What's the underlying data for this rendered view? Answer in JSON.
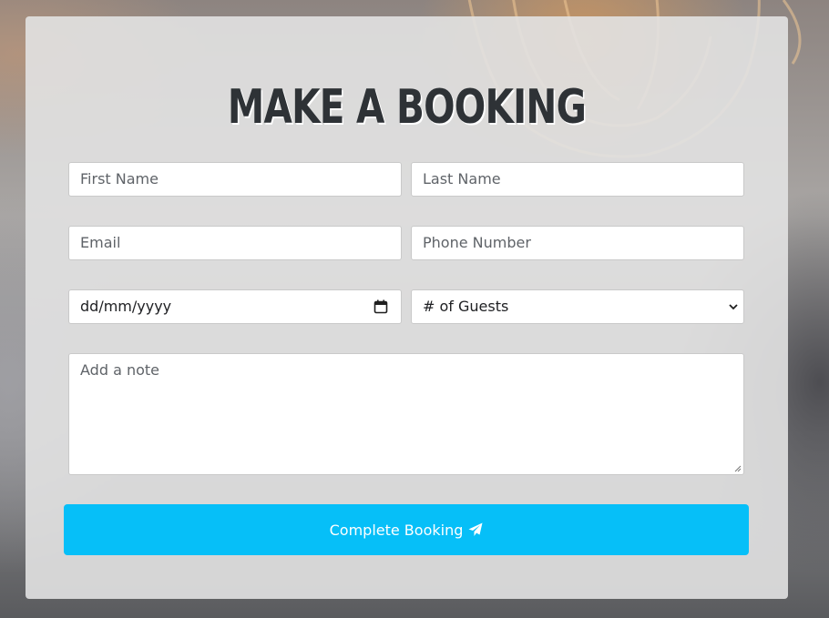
{
  "form": {
    "title": "MAKE A BOOKING",
    "first_name_placeholder": "First Name",
    "last_name_placeholder": "Last Name",
    "email_placeholder": "Email",
    "phone_placeholder": "Phone Number",
    "date_placeholder": "dd/mm/yyyy",
    "guests_selected": "# of Guests",
    "note_placeholder": "Add a note",
    "submit_label": "Complete Booking"
  },
  "icons": {
    "date": "calendar-icon",
    "guests": "chevron-down-icon",
    "submit": "paper-plane-icon",
    "note": "resize-handle-icon"
  },
  "colors": {
    "accent": "#06bff8",
    "title": "#2e3236",
    "card": "#e2e2e2"
  }
}
